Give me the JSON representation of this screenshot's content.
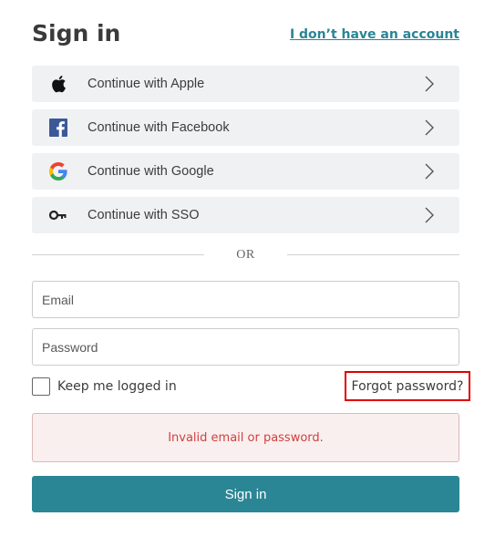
{
  "header": {
    "title": "Sign in",
    "no_account_link": "I don’t have an account"
  },
  "providers": [
    {
      "label": "Continue with Apple",
      "icon": "apple-icon"
    },
    {
      "label": "Continue with Facebook",
      "icon": "facebook-icon"
    },
    {
      "label": "Continue with Google",
      "icon": "google-icon"
    },
    {
      "label": "Continue with SSO",
      "icon": "key-icon"
    }
  ],
  "divider": {
    "text": "OR"
  },
  "form": {
    "email_placeholder": "Email",
    "email_value": "",
    "password_placeholder": "Password",
    "password_value": "",
    "keep_logged_in_label": "Keep me logged in",
    "keep_logged_in_checked": false,
    "forgot_password_label": "Forgot password?",
    "error_message": "Invalid email or password.",
    "submit_label": "Sign in"
  },
  "colors": {
    "accent": "#2a8595",
    "error_text": "#d04040",
    "error_bg": "#f9efef",
    "highlight_box": "#e00000",
    "provider_bg": "#f0f1f3"
  }
}
